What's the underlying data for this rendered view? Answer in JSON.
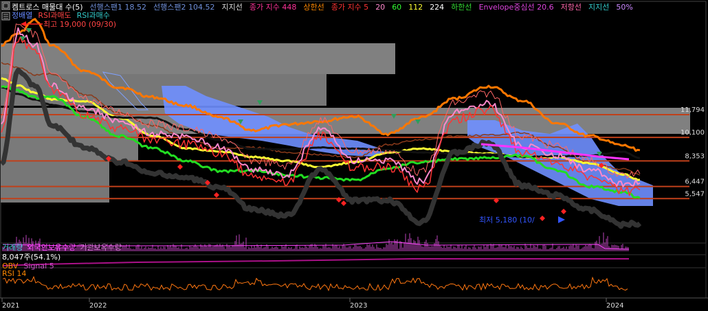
{
  "legend_top": {
    "title": "켐트로스 매물대 수(5)",
    "items": [
      {
        "text": "선행스팬1 18.52",
        "color": "#6f8fd8"
      },
      {
        "text": "선행스팬2 104.52",
        "color": "#6f8fd8"
      },
      {
        "text": "지지선",
        "color": "#dddddd"
      },
      {
        "text": "종가 지수 448",
        "color": "#ff3399"
      },
      {
        "text": "상한선",
        "color": "#ff8800"
      },
      {
        "text": "종가 지수 5",
        "color": "#ff3333"
      },
      {
        "text": "20",
        "color": "#ff88cc"
      },
      {
        "text": "60",
        "color": "#33ff33"
      },
      {
        "text": "112",
        "color": "#ffff33"
      },
      {
        "text": "224",
        "color": "#ffffff"
      },
      {
        "text": "하한선",
        "color": "#33dd33"
      },
      {
        "text": "Envelope중심선 20.6",
        "color": "#dd44dd"
      },
      {
        "text": "저항선",
        "color": "#ff66aa"
      },
      {
        "text": "지지선",
        "color": "#33cccc"
      },
      {
        "text": "50%",
        "color": "#cc88ff"
      }
    ],
    "row2": [
      {
        "text": "정배열",
        "color": "#6688ff"
      },
      {
        "text": "RSI과매도",
        "color": "#ff4444"
      },
      {
        "text": "RSI과매수",
        "color": "#33cccc"
      }
    ]
  },
  "annotations": {
    "high": "최고 19,000 (09/30)",
    "low": "최저 5,180 (10/"
  },
  "volume_legend": [
    {
      "text": "거래량",
      "color": "#33cccc"
    },
    {
      "text": "외국인보유수량",
      "color": "#ff44ff"
    },
    {
      "text": "기관보유수량",
      "color": "#cc77cc"
    }
  ],
  "volume_readout": "8,047주(54.1%)",
  "obv_legend": [
    {
      "text": "OBV",
      "color": "#ff8800"
    },
    {
      "text": "Signal 5",
      "color": "#cc55cc"
    }
  ],
  "rsi_legend": [
    {
      "text": "RSI 14",
      "color": "#ff8800"
    }
  ],
  "price_levels": [
    "11,794",
    "10,100",
    "8,353",
    "6,447",
    "5,547"
  ],
  "x_axis": [
    "2021",
    "2022",
    "2023",
    "2024"
  ],
  "colors": {
    "background": "#000000",
    "volume_profile": "#808080",
    "cloud": "#6f8fff",
    "level_line": "#c0401a",
    "ma_black": "#111111",
    "ma_white": "#ffffff",
    "ma_yellow": "#ffff33",
    "ma_green": "#22dd22",
    "price_red": "#ff3333",
    "upper_band": "#ff7700",
    "envelope": "#ff33ff"
  },
  "chart_data": {
    "type": "line",
    "title": "",
    "xlabel": "",
    "ylabel": "",
    "ylim": [
      4500,
      20000
    ],
    "x": [
      "2021-01",
      "2021-02",
      "2021-03",
      "2021-04",
      "2021-06",
      "2021-08",
      "2021-10",
      "2021-12",
      "2022-02",
      "2022-04",
      "2022-06",
      "2022-08",
      "2022-10",
      "2022-12",
      "2023-02",
      "2023-04",
      "2023-06",
      "2023-08",
      "2023-10",
      "2023-12",
      "2024-02",
      "2024-03"
    ],
    "series": [
      {
        "name": "종가 지수 5",
        "values": [
          10500,
          17500,
          16500,
          13500,
          11800,
          10800,
          9900,
          9600,
          8900,
          7200,
          6800,
          10200,
          7900,
          7900,
          6300,
          11500,
          12200,
          9000,
          8300,
          7200,
          6100,
          6200
        ]
      }
    ],
    "price_levels": [
      11794,
      10100,
      8353,
      6447,
      5547
    ],
    "annotations": [
      {
        "label": "최고",
        "value": 19000,
        "date": "09/30"
      },
      {
        "label": "최저",
        "value": 5180
      }
    ]
  }
}
